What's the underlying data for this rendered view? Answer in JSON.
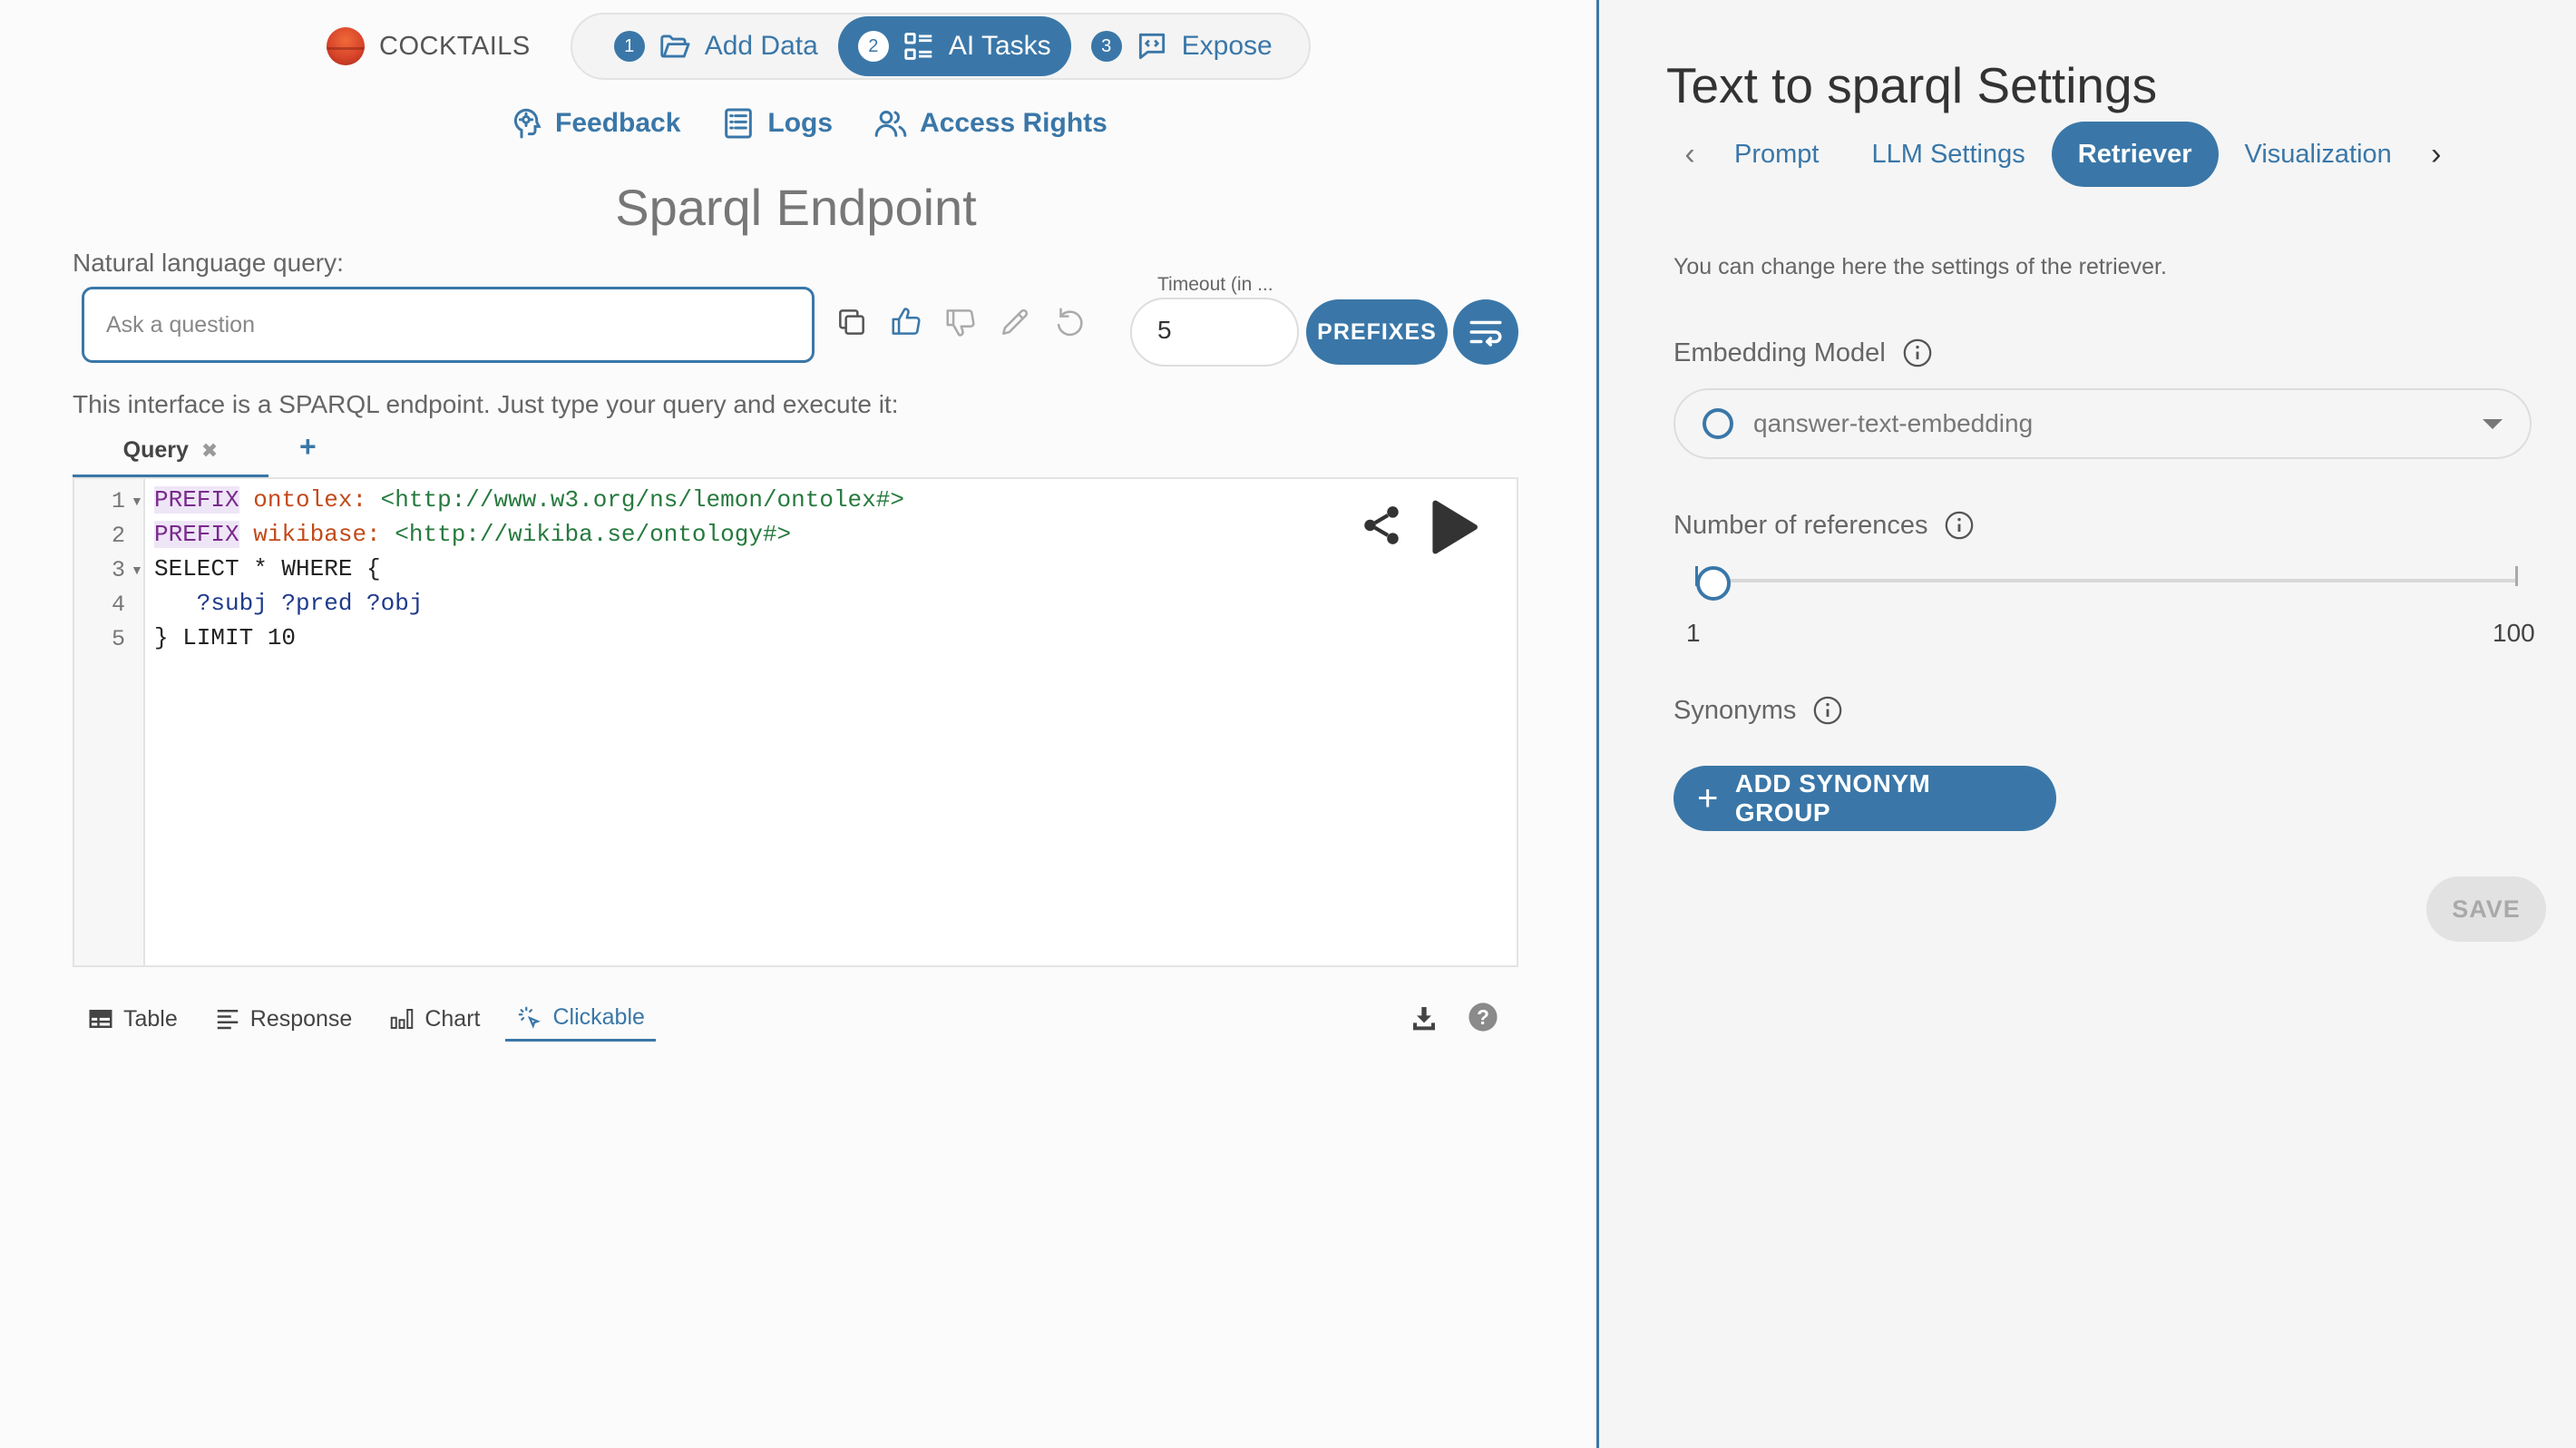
{
  "brand": {
    "name": "COCKTAILS"
  },
  "stepper": [
    {
      "num": "1",
      "label": "Add Data",
      "icon": "folder-open-icon",
      "active": false
    },
    {
      "num": "2",
      "label": "AI Tasks",
      "icon": "list-icon",
      "active": true
    },
    {
      "num": "3",
      "label": "Expose",
      "icon": "code-bubble-icon",
      "active": false
    }
  ],
  "nav": {
    "feedback": "Feedback",
    "logs": "Logs",
    "access": "Access Rights"
  },
  "page": {
    "title": "Sparql Endpoint",
    "nlq_label": "Natural language query:",
    "ask_placeholder": "Ask a question",
    "timeout_label": "Timeout (in ...",
    "timeout_value": "5",
    "prefixes": "PREFIXES",
    "intro": "This interface is a SPARQL endpoint. Just type your query and execute it:"
  },
  "query_tab": {
    "label": "Query",
    "close": "✖",
    "add": "+"
  },
  "editor": {
    "line_numbers": [
      "1",
      "2",
      "3",
      "4",
      "5"
    ],
    "lines": [
      {
        "kw": "PREFIX",
        "prefix": "ontolex:",
        "iri": "<http://www.w3.org/ns/lemon/ontolex#>"
      },
      {
        "kw": "PREFIX",
        "prefix": "wikibase:",
        "iri": "<http://wikiba.se/ontology#>"
      },
      {
        "text": "SELECT * WHERE {"
      },
      {
        "text": "   ?subj ?pred ?obj"
      },
      {
        "text": "} LIMIT 10"
      }
    ]
  },
  "result_tabs": [
    {
      "label": "Table",
      "icon": "table-icon"
    },
    {
      "label": "Response",
      "icon": "lines-icon"
    },
    {
      "label": "Chart",
      "icon": "bar-chart-icon"
    },
    {
      "label": "Clickable",
      "icon": "click-icon",
      "active": true
    }
  ],
  "settings": {
    "title": "Text to sparql Settings",
    "tabs": [
      "Prompt",
      "LLM Settings",
      "Retriever",
      "Visualization"
    ],
    "active_tab": "Retriever",
    "description": "You can change here the settings of the retriever.",
    "embedding_label": "Embedding Model",
    "embedding_value": "qanswer-text-embedding",
    "references_label": "Number of references",
    "references_min": "1",
    "references_max": "100",
    "references_value": 3,
    "synonyms_label": "Synonyms",
    "add_synonym": "ADD SYNONYM GROUP",
    "save": "SAVE"
  },
  "colors": {
    "accent": "#3a77a8",
    "background": "#fbfbfb",
    "panel": "#f5f5f5"
  }
}
